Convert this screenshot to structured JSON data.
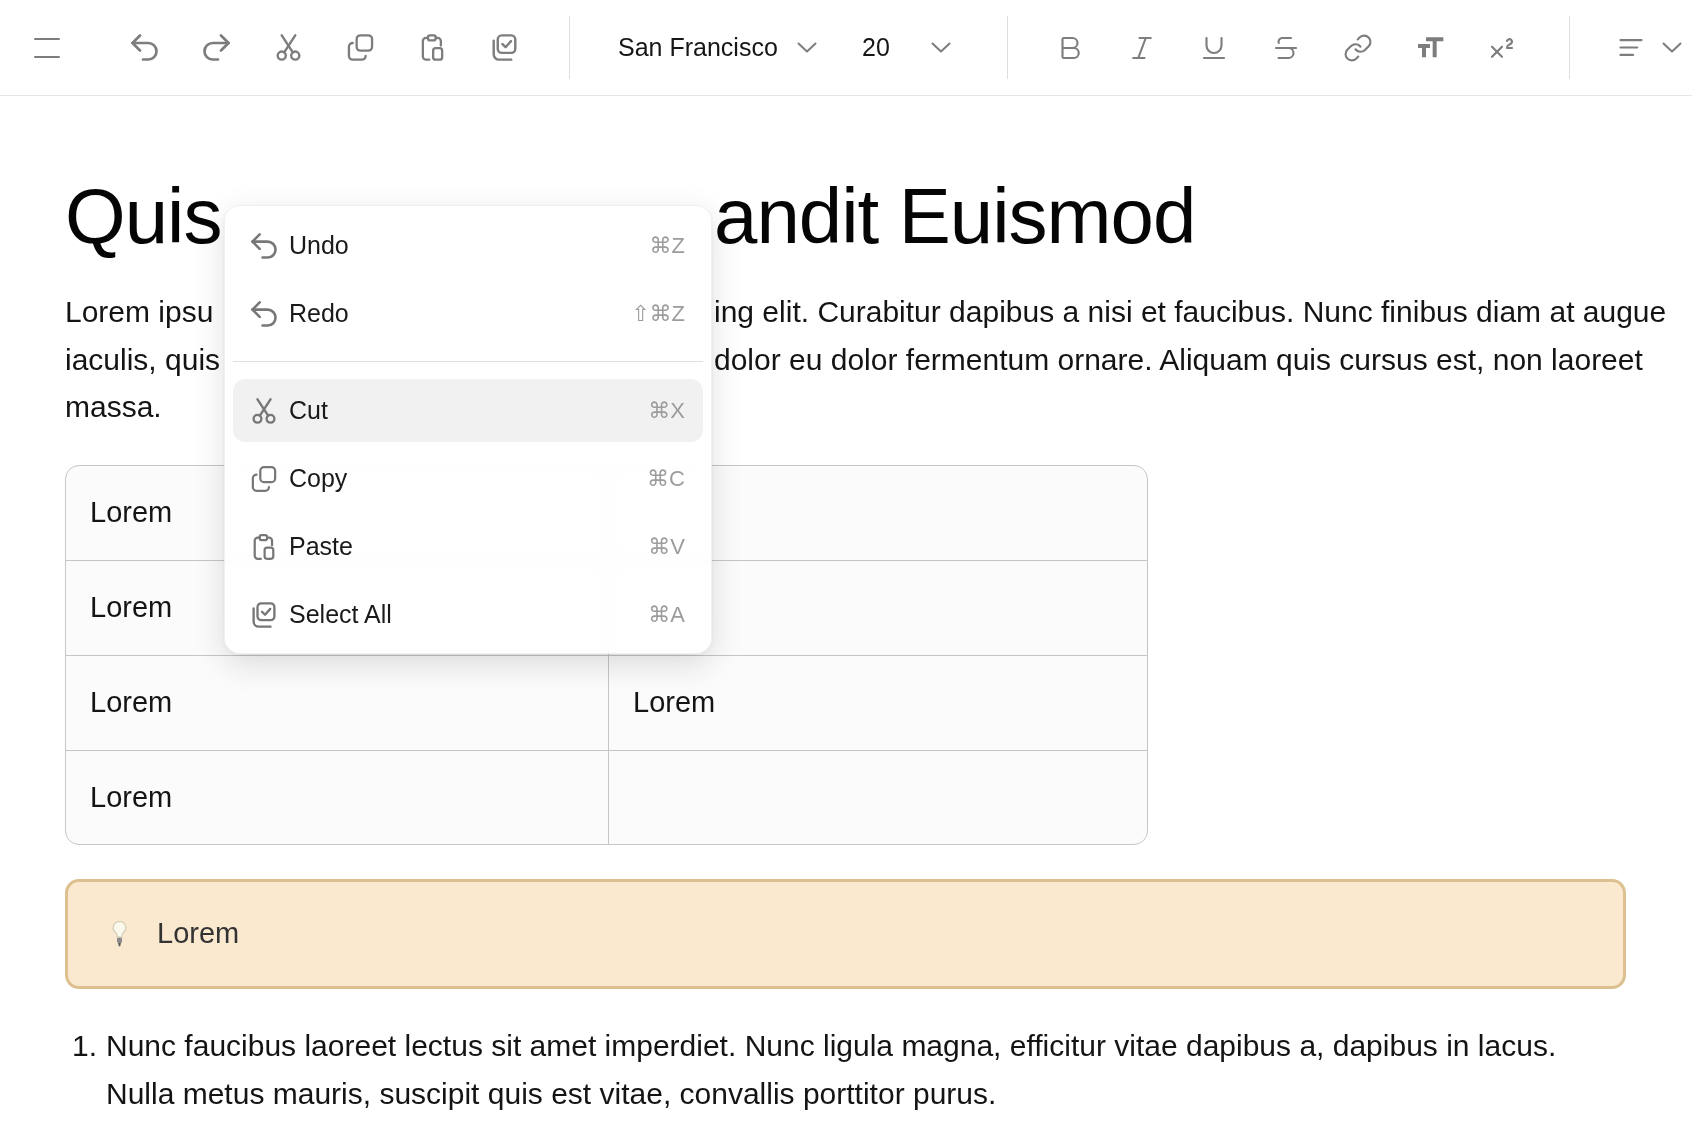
{
  "toolbar": {
    "font_family": "San Francisco",
    "font_size": "20"
  },
  "document": {
    "title": {
      "text_left_of_menu": "Quis",
      "text_right_of_menu": "andit Euismod"
    },
    "paragraph": {
      "lines": [
        {
          "text_left_of_menu": "Lorem ipsu",
          "text_right_of_menu": "ing elit. Curabitur dapibus a nisi et faucibus. Nunc finibus diam at augue"
        },
        {
          "text_left_of_menu": "iaculis, quis",
          "text_right_of_menu": "dolor eu dolor fermentum ornare. Aliquam quis cursus est, non laoreet"
        },
        {
          "text_left_of_menu": "massa."
        }
      ]
    },
    "table": {
      "rows": [
        {
          "column_1": "Lorem"
        },
        {
          "column_1": "Lorem"
        },
        {
          "column_1": "Lorem",
          "column_2": "Lorem"
        },
        {
          "column_1": "Lorem"
        }
      ]
    },
    "callout": {
      "text": "Lorem"
    },
    "ordered_list": [
      {
        "number": "1.",
        "text": "Nunc faucibus laoreet lectus sit amet imperdiet. Nunc ligula magna, efficitur vitae dapibus a, dapibus in lacus. Nulla metus mauris, suscipit quis est vitae, convallis porttitor purus."
      }
    ]
  },
  "context_menu": {
    "groups": [
      [
        {
          "label": "Undo",
          "shortcut": "⌘Z",
          "selected": false
        },
        {
          "label": "Redo",
          "shortcut": "⇧⌘Z",
          "selected": false
        }
      ],
      [
        {
          "label": "Cut",
          "shortcut": "⌘X",
          "selected": true
        },
        {
          "label": "Copy",
          "shortcut": "⌘C",
          "selected": false
        },
        {
          "label": "Paste",
          "shortcut": "⌘V",
          "selected": false
        },
        {
          "label": "Select All",
          "shortcut": "⌘A",
          "selected": false
        }
      ]
    ]
  }
}
